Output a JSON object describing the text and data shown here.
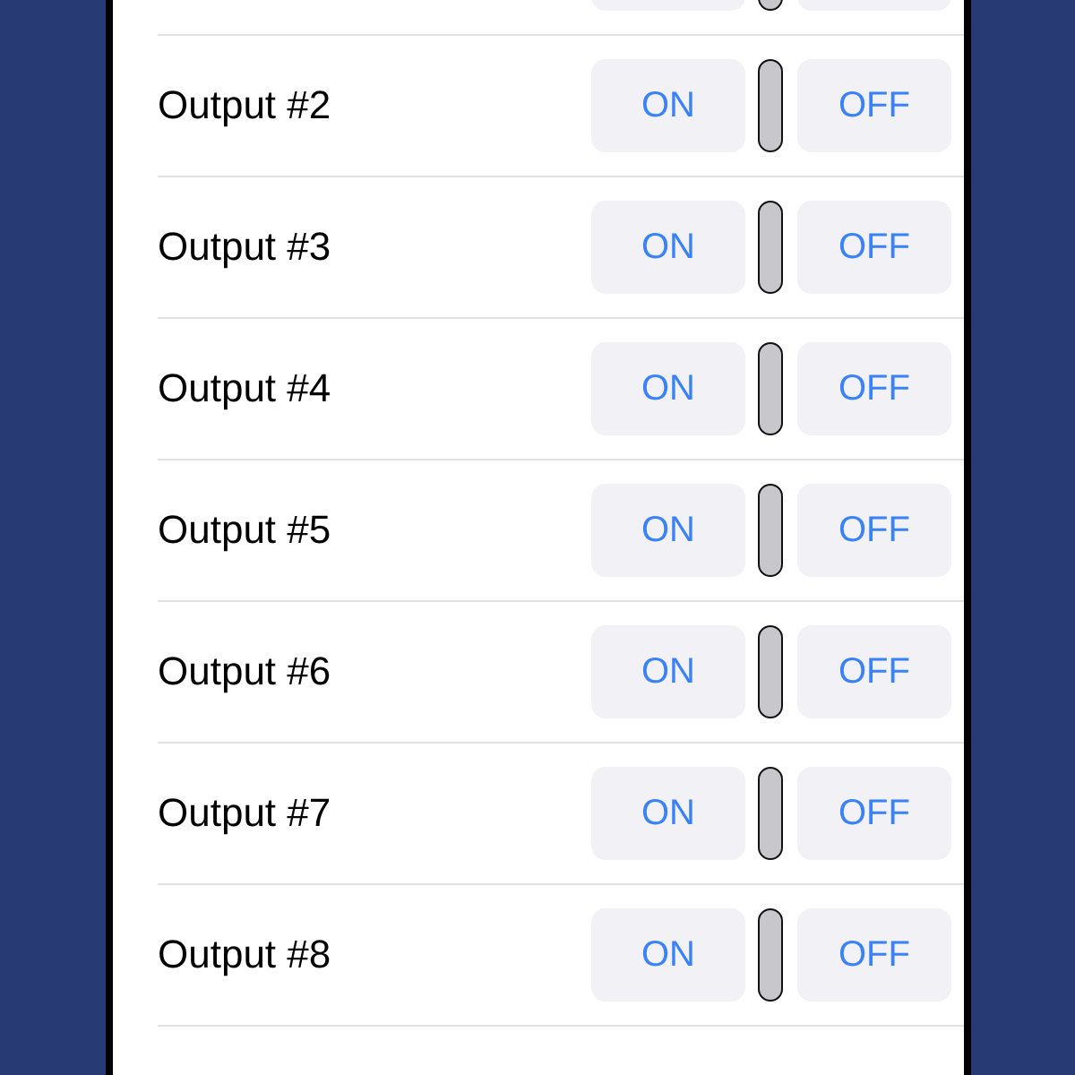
{
  "outputs": [
    {
      "kind": "clipped",
      "on": false
    },
    {
      "kind": "full",
      "label": "Output #2",
      "on_button": "ON",
      "off_button": "OFF",
      "on": false
    },
    {
      "kind": "full",
      "label": "Output #3",
      "on_button": "ON",
      "off_button": "OFF",
      "on": false
    },
    {
      "kind": "full",
      "label": "Output #4",
      "on_button": "ON",
      "off_button": "OFF",
      "on": false
    },
    {
      "kind": "full",
      "label": "Output #5",
      "on_button": "ON",
      "off_button": "OFF",
      "on": false
    },
    {
      "kind": "full",
      "label": "Output #6",
      "on_button": "ON",
      "off_button": "OFF",
      "on": false
    },
    {
      "kind": "full",
      "label": "Output #7",
      "on_button": "ON",
      "off_button": "OFF",
      "on": false
    },
    {
      "kind": "full",
      "label": "Output #8",
      "on_button": "ON",
      "off_button": "OFF",
      "on": false
    }
  ]
}
